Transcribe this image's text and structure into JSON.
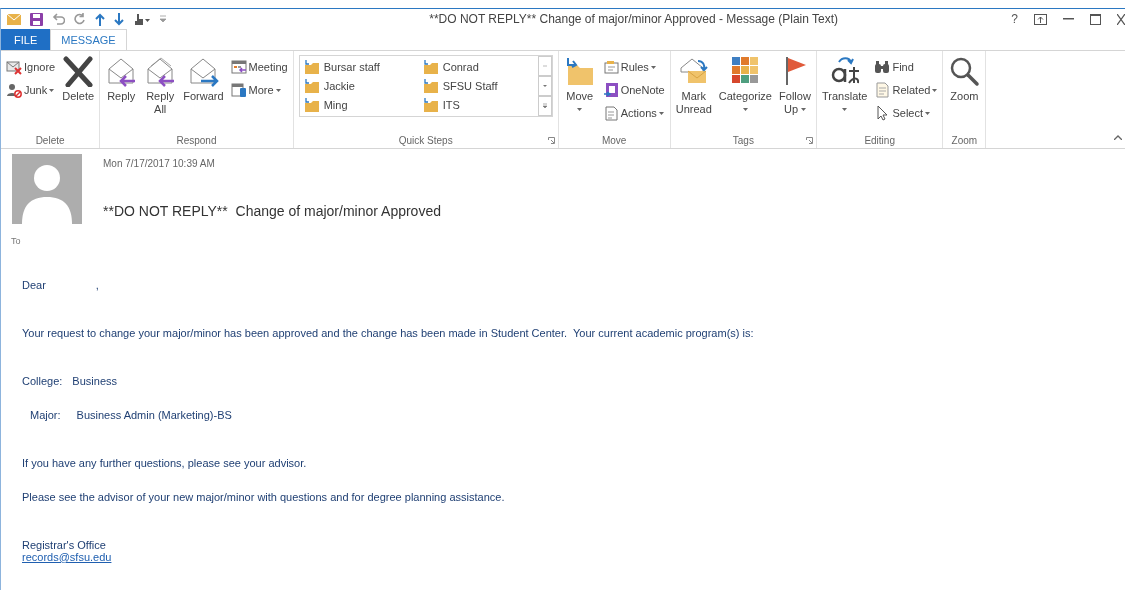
{
  "window": {
    "title": "**DO NOT REPLY**  Change of major/minor Approved - Message (Plain Text)",
    "help": "?"
  },
  "tabs": [
    {
      "label": "FILE",
      "kind": "file",
      "selected": false
    },
    {
      "label": "MESSAGE",
      "kind": "tab",
      "selected": true
    }
  ],
  "ribbon": [
    {
      "name": "Delete",
      "kind": "buttons",
      "items": [
        {
          "kind": "small",
          "lines": [
            "Ignore"
          ],
          "dropdown": false
        },
        {
          "kind": "small",
          "lines": [
            "Junk"
          ],
          "dropdown": true
        },
        {
          "kind": "large",
          "lines": [
            "Delete"
          ],
          "dropdown": false
        }
      ]
    },
    {
      "name": "Respond",
      "kind": "buttons",
      "items": [
        {
          "kind": "large",
          "lines": [
            "Reply"
          ],
          "dropdown": false
        },
        {
          "kind": "large",
          "lines": [
            "Reply",
            "All"
          ],
          "dropdown": false
        },
        {
          "kind": "large",
          "lines": [
            "Forward"
          ],
          "dropdown": false
        },
        {
          "kind": "small",
          "lines": [
            "Meeting"
          ],
          "dropdown": false
        },
        {
          "kind": "small",
          "lines": [
            "More"
          ],
          "dropdown": true
        }
      ]
    },
    {
      "name": "Quick Steps",
      "kind": "gallery",
      "launcher": true,
      "items": [
        {
          "lines": [
            "Bursar staff"
          ]
        },
        {
          "lines": [
            "Jackie"
          ]
        },
        {
          "lines": [
            "Ming"
          ]
        },
        {
          "lines": [
            "Conrad"
          ]
        },
        {
          "lines": [
            "SFSU Staff"
          ]
        },
        {
          "lines": [
            "ITS"
          ]
        }
      ]
    },
    {
      "name": "Move",
      "kind": "buttons",
      "items": [
        {
          "kind": "large",
          "lines": [
            "Move"
          ],
          "dropdown": true
        },
        {
          "kind": "small",
          "lines": [
            "Rules"
          ],
          "dropdown": true
        },
        {
          "kind": "small",
          "lines": [
            "OneNote"
          ],
          "dropdown": false
        },
        {
          "kind": "small",
          "lines": [
            "Actions"
          ],
          "dropdown": true
        }
      ]
    },
    {
      "name": "Tags",
      "kind": "buttons",
      "launcher": true,
      "items": [
        {
          "kind": "large",
          "lines": [
            "Mark",
            "Unread"
          ],
          "dropdown": false
        },
        {
          "kind": "large",
          "lines": [
            "Categorize"
          ],
          "dropdown": true
        },
        {
          "kind": "large",
          "lines": [
            "Follow",
            "Up"
          ],
          "dropdown": true
        }
      ]
    },
    {
      "name": "Editing",
      "kind": "buttons",
      "items": [
        {
          "kind": "large",
          "lines": [
            "Translate"
          ],
          "dropdown": true
        },
        {
          "kind": "small",
          "lines": [
            "Find"
          ],
          "dropdown": false
        },
        {
          "kind": "small",
          "lines": [
            "Related"
          ],
          "dropdown": true
        },
        {
          "kind": "small",
          "lines": [
            "Select"
          ],
          "dropdown": true
        }
      ]
    },
    {
      "name": "Zoom",
      "kind": "buttons",
      "items": [
        {
          "kind": "large",
          "lines": [
            "Zoom"
          ],
          "dropdown": false
        }
      ]
    }
  ],
  "message": {
    "date": "Mon 7/17/2017 10:39 AM",
    "subject": "**DO NOT REPLY**  Change of major/minor Approved",
    "to_label": "To",
    "body": [
      {
        "kind": "greeting",
        "text": "Dear",
        "suffix": ","
      },
      {
        "kind": "paragraph",
        "text": "Your request to change your major/minor has been approved and the change has been made in Student Center.  Your current academic program(s) is:"
      },
      {
        "kind": "field",
        "label": "College:",
        "value": "Business",
        "children": [
          {
            "label": "Major:",
            "value": "Business Admin (Marketing)-BS"
          }
        ]
      },
      {
        "kind": "paragraph",
        "text": "If you have any further questions, please see your advisor."
      },
      {
        "kind": "paragraph",
        "text": "Please see the advisor of your new major/minor with questions and for degree planning assistance."
      },
      {
        "kind": "signature",
        "text": "Registrar's Office"
      },
      {
        "kind": "link",
        "text": "records@sfsu.edu"
      }
    ]
  }
}
